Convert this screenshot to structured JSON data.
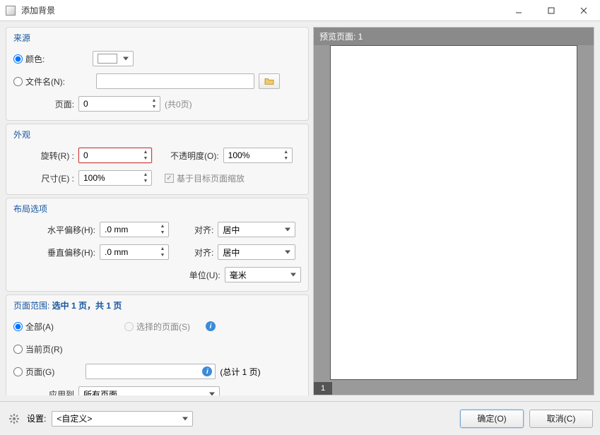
{
  "window": {
    "title": "添加背景",
    "buttons": {
      "min": "—",
      "max": "▢",
      "close": "✕"
    }
  },
  "source": {
    "title": "来源",
    "color_label": "颜色:",
    "color_value": "#ffffff",
    "filename_label": "文件名(N):",
    "filename_value": "",
    "pages_label": "页面:",
    "pages_value": "0",
    "pages_total": "(共0页)",
    "selected": "color"
  },
  "appearance": {
    "title": "外观",
    "rotate_label": "旋转(R) :",
    "rotate_value": "0",
    "opacity_label": "不透明度(O):",
    "opacity_value": "100%",
    "size_label": "尺寸(E) :",
    "size_value": "100%",
    "scale_to_target_label": "基于目标页面缩放",
    "scale_to_target_checked": true
  },
  "layout": {
    "title": "布局选项",
    "hoffset_label": "水平偏移(H):",
    "hoffset_value": ".0 mm",
    "voffset_label": "垂直偏移(H):",
    "voffset_value": ".0 mm",
    "align_label": "对齐:",
    "halign_value": "居中",
    "valign_value": "居中",
    "unit_label": "单位(U):",
    "unit_value": "毫米"
  },
  "range": {
    "title_prefix": "页面范围: ",
    "title_summary": "选中 1 页，共 1 页",
    "all_label": "全部(A)",
    "selected_label": "选择的页面(S)",
    "current_label": "当前页(R)",
    "pages_label": "页面(G)",
    "pages_value": "",
    "pages_total": "(总计 1 页)",
    "apply_to_label": "应用到",
    "apply_to_value": "所有页面",
    "selected_radio": "all"
  },
  "preview": {
    "title": "预览页面: 1",
    "page_number": "1"
  },
  "bottom": {
    "settings_label": "设置:",
    "settings_value": "<自定义>",
    "ok_label": "确定(O)",
    "cancel_label": "取消(C)"
  }
}
